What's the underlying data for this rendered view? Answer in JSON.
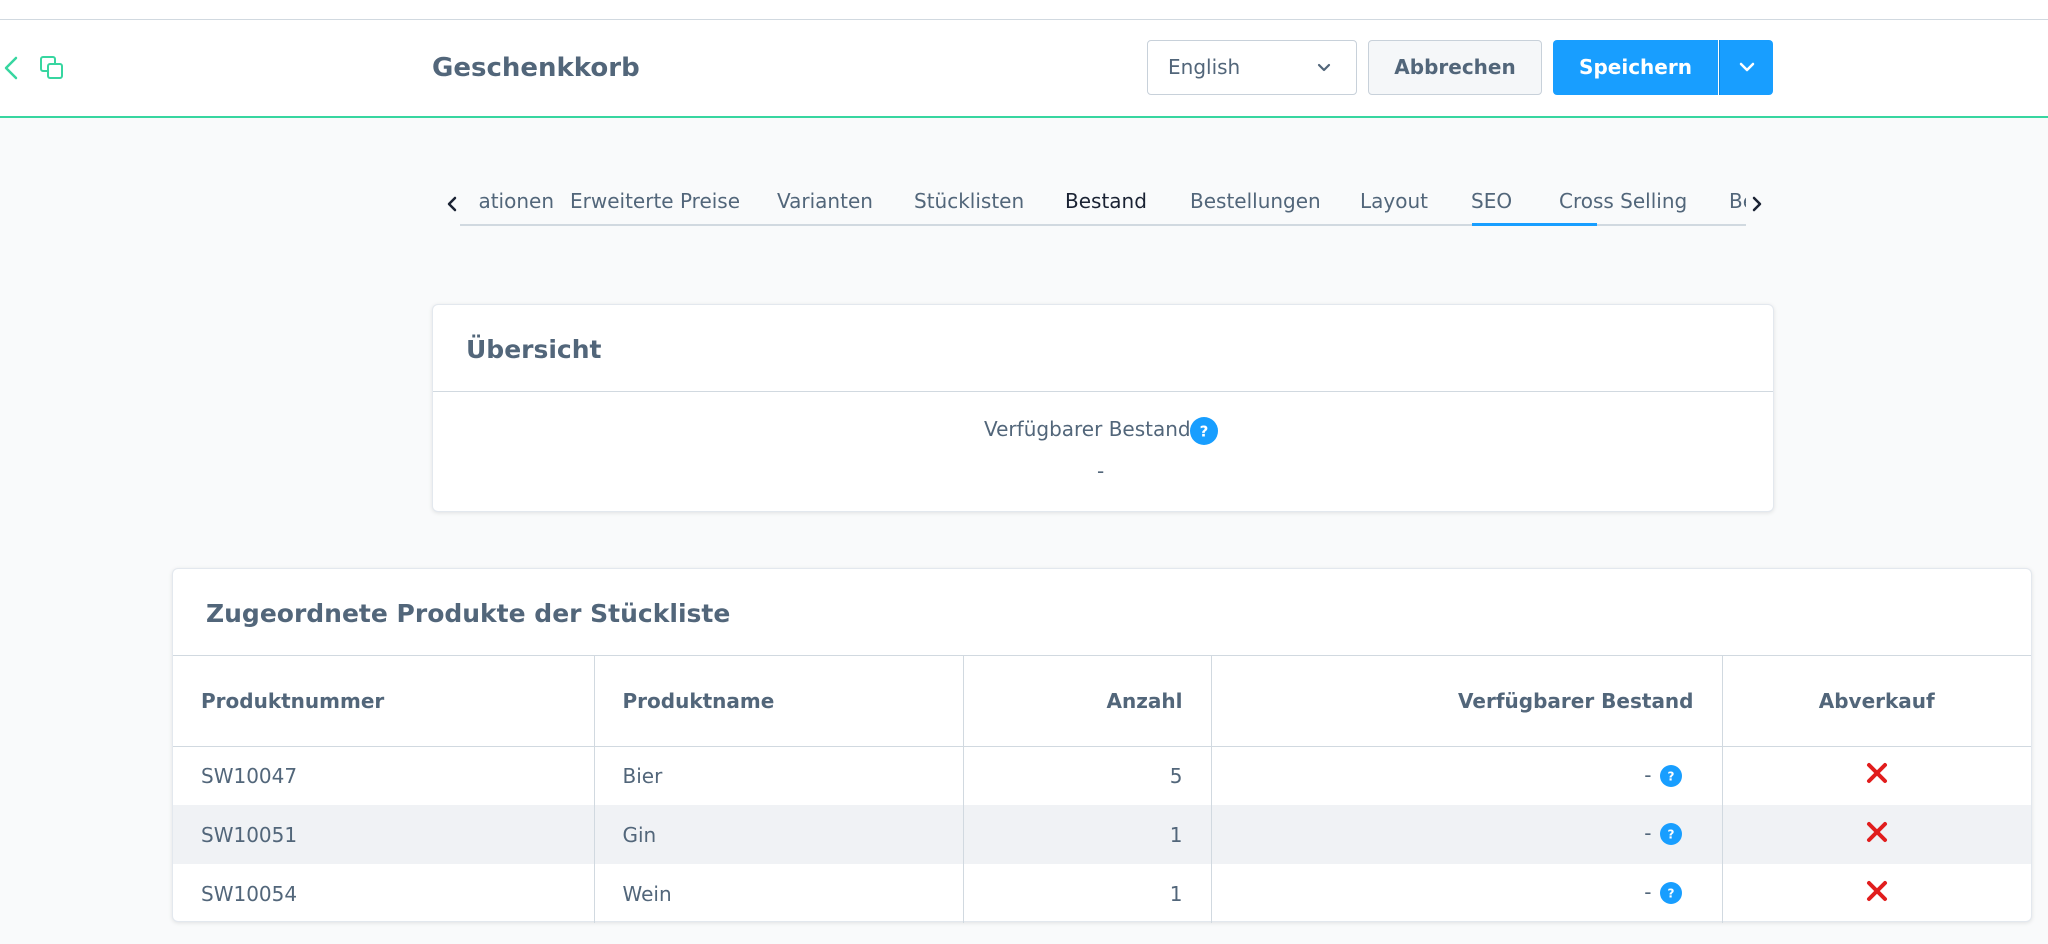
{
  "header": {
    "title": "Geschenkkorb",
    "language": "English",
    "cancel_label": "Abbrechen",
    "save_label": "Speichern",
    "accent_color": "#37d6a0",
    "primary_color": "#189eff"
  },
  "tabs": {
    "items": [
      {
        "label": "ationen",
        "partial": true
      },
      {
        "label": "Erweiterte Preise"
      },
      {
        "label": "Varianten"
      },
      {
        "label": "Stücklisten"
      },
      {
        "label": "Bestand",
        "active": true
      },
      {
        "label": "Bestellungen"
      },
      {
        "label": "Layout"
      },
      {
        "label": "SEO"
      },
      {
        "label": "Cross Selling"
      },
      {
        "label": "Be",
        "partial": true
      }
    ]
  },
  "overview": {
    "title": "Übersicht",
    "stock_label": "Verfügbarer Bestand",
    "stock_value": "-"
  },
  "products": {
    "title": "Zugeordnete Produkte der Stückliste",
    "columns": [
      "Produktnummer",
      "Produktname",
      "Anzahl",
      "Verfügbarer Bestand",
      "Abverkauf"
    ],
    "rows": [
      {
        "number": "SW10047",
        "name": "Bier",
        "quantity": "5",
        "stock": "-",
        "sale": false
      },
      {
        "number": "SW10051",
        "name": "Gin",
        "quantity": "1",
        "stock": "-",
        "sale": false
      },
      {
        "number": "SW10054",
        "name": "Wein",
        "quantity": "1",
        "stock": "-",
        "sale": false
      }
    ]
  }
}
